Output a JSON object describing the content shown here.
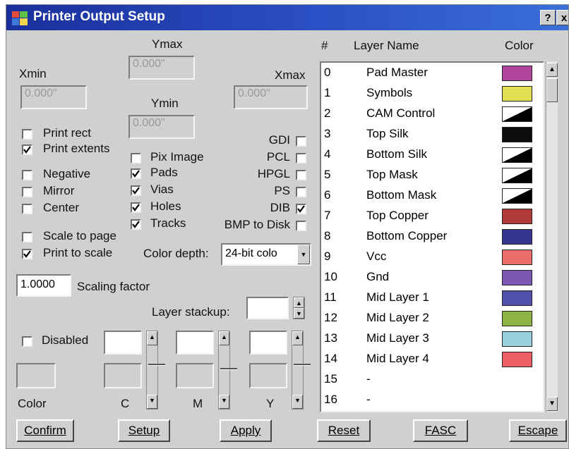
{
  "window": {
    "title": "Printer Output Setup",
    "help_label": "?",
    "close_label": "x"
  },
  "coords": {
    "ymax_label": "Ymax",
    "ymax_value": "0.000\"",
    "xmin_label": "Xmin",
    "xmin_value": "0.000\"",
    "xmax_label": "Xmax",
    "xmax_value": "0.000\"",
    "ymin_label": "Ymin",
    "ymin_value": "0.000\""
  },
  "print_options": [
    {
      "label": "Print rect",
      "checked": false
    },
    {
      "label": "Print extents",
      "checked": true
    },
    {
      "label": "Negative",
      "checked": false
    },
    {
      "label": "Mirror",
      "checked": false
    },
    {
      "label": "Center",
      "checked": false
    },
    {
      "label": "Scale to page",
      "checked": false
    },
    {
      "label": "Print to scale",
      "checked": true
    }
  ],
  "content_options": [
    {
      "label": "Pix Image",
      "checked": false
    },
    {
      "label": "Pads",
      "checked": true
    },
    {
      "label": "Vias",
      "checked": true
    },
    {
      "label": "Holes",
      "checked": true
    },
    {
      "label": "Tracks",
      "checked": true
    }
  ],
  "output_formats": [
    {
      "label": "GDI",
      "checked": false
    },
    {
      "label": "PCL",
      "checked": false
    },
    {
      "label": "HPGL",
      "checked": false
    },
    {
      "label": "PS",
      "checked": false
    },
    {
      "label": "DIB",
      "checked": true
    },
    {
      "label": "BMP to Disk",
      "checked": false
    }
  ],
  "color_depth": {
    "label": "Color depth:",
    "value": "24-bit colo"
  },
  "scaling": {
    "value": "1.0000",
    "label": "Scaling factor"
  },
  "layer_stackup": {
    "label": "Layer stackup:",
    "value": ""
  },
  "color_mix": {
    "disabled_label": "Disabled",
    "disabled_checked": false,
    "color_label": "Color",
    "channels": [
      "C",
      "M",
      "Y"
    ]
  },
  "layers": {
    "headers": {
      "num": "#",
      "name": "Layer Name",
      "color": "Color"
    },
    "rows": [
      {
        "num": "0",
        "name": "Pad Master",
        "color": "#b0449a",
        "style": "solid"
      },
      {
        "num": "1",
        "name": "Symbols",
        "color": "#e2df52",
        "style": "solid"
      },
      {
        "num": "2",
        "name": "CAM Control",
        "color": "#000000",
        "style": "split"
      },
      {
        "num": "3",
        "name": "Top Silk",
        "color": "#0d0d0d",
        "style": "solid"
      },
      {
        "num": "4",
        "name": "Bottom Silk",
        "color": "#000000",
        "style": "split"
      },
      {
        "num": "5",
        "name": "Top Mask",
        "color": "#000000",
        "style": "split"
      },
      {
        "num": "6",
        "name": "Bottom Mask",
        "color": "#000000",
        "style": "split"
      },
      {
        "num": "7",
        "name": "Top Copper",
        "color": "#b13a3a",
        "style": "solid"
      },
      {
        "num": "8",
        "name": "Bottom Copper",
        "color": "#36368e",
        "style": "solid"
      },
      {
        "num": "9",
        "name": "Vcc",
        "color": "#ec6c6a",
        "style": "solid"
      },
      {
        "num": "10",
        "name": "Gnd",
        "color": "#7a58b3",
        "style": "solid"
      },
      {
        "num": "11",
        "name": "Mid Layer 1",
        "color": "#5050a8",
        "style": "solid"
      },
      {
        "num": "12",
        "name": "Mid Layer 2",
        "color": "#8cb545",
        "style": "solid"
      },
      {
        "num": "13",
        "name": "Mid Layer 3",
        "color": "#9bd1dd",
        "style": "solid"
      },
      {
        "num": "14",
        "name": "Mid Layer 4",
        "color": "#ec5e62",
        "style": "solid"
      },
      {
        "num": "15",
        "name": "-",
        "color": "",
        "style": "none"
      },
      {
        "num": "16",
        "name": "-",
        "color": "",
        "style": "none"
      }
    ]
  },
  "buttons": {
    "confirm": "Confirm",
    "setup": "Setup",
    "apply": "Apply",
    "reset": "Reset",
    "fasc": "FASC",
    "escape": "Escape"
  }
}
